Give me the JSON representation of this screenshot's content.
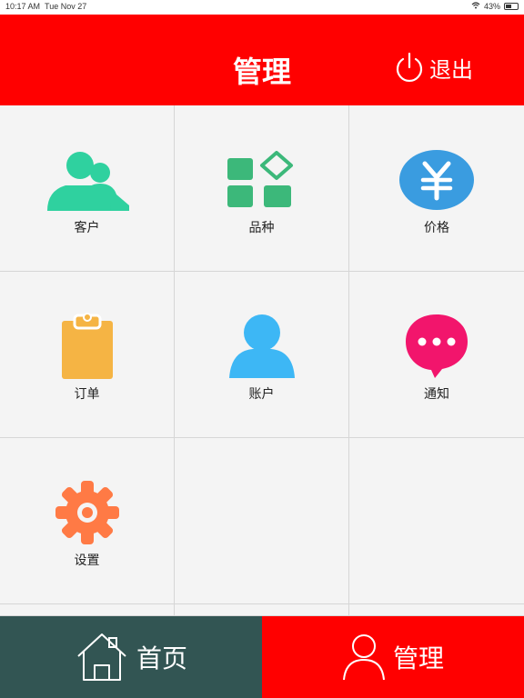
{
  "status_bar": {
    "time": "10:17 AM",
    "date": "Tue Nov 27",
    "battery": "43%"
  },
  "header": {
    "title": "管理",
    "logout_label": "退出"
  },
  "grid": {
    "items": [
      {
        "label": "客户",
        "icon": "customers-icon",
        "color": "#2fd19f"
      },
      {
        "label": "品种",
        "icon": "category-icon",
        "color": "#3cb87a"
      },
      {
        "label": "价格",
        "icon": "yen-icon",
        "color": "#3a9ce0"
      },
      {
        "label": "订单",
        "icon": "clipboard-icon",
        "color": "#f5b444"
      },
      {
        "label": "账户",
        "icon": "account-icon",
        "color": "#3db7f5"
      },
      {
        "label": "通知",
        "icon": "message-icon",
        "color": "#f2156c"
      },
      {
        "label": "设置",
        "icon": "settings-icon",
        "color": "#ff7a45"
      }
    ]
  },
  "tabbar": {
    "home_label": "首页",
    "manage_label": "管理"
  }
}
